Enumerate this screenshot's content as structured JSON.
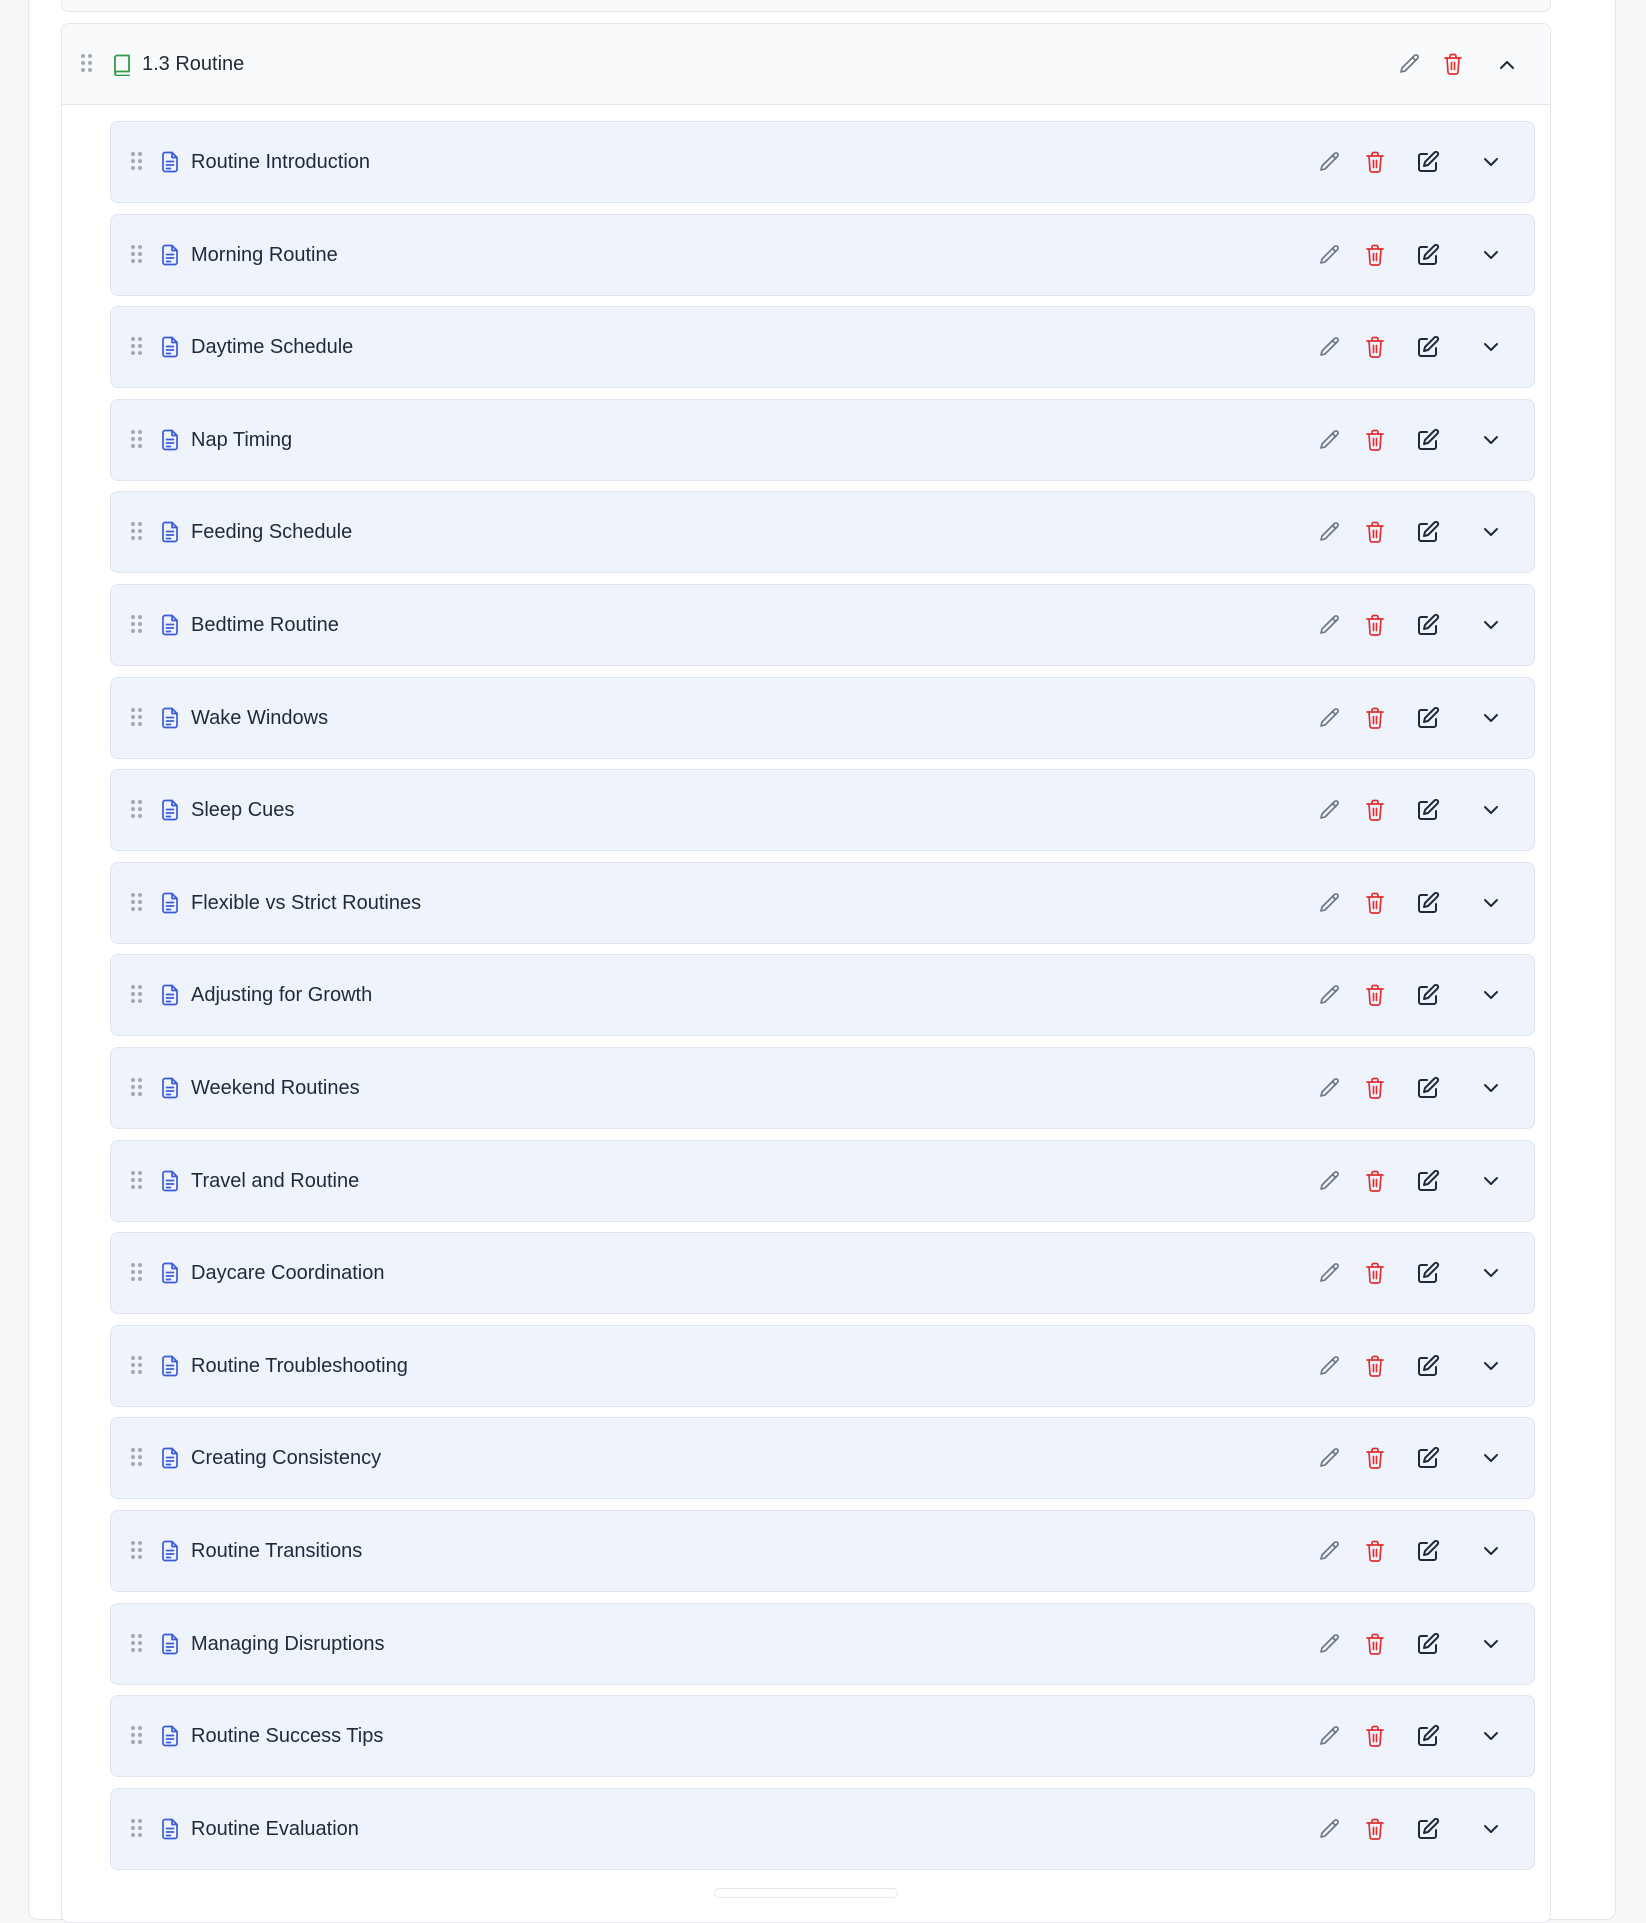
{
  "module": {
    "title": "1.3 Routine",
    "icon": "book-icon",
    "actions": [
      "edit-icon",
      "trash-icon",
      "chevron-up-icon"
    ]
  },
  "lessons": [
    {
      "title": "Routine Introduction"
    },
    {
      "title": "Morning Routine"
    },
    {
      "title": "Daytime Schedule"
    },
    {
      "title": "Nap Timing"
    },
    {
      "title": "Feeding Schedule"
    },
    {
      "title": "Bedtime Routine"
    },
    {
      "title": "Wake Windows"
    },
    {
      "title": "Sleep Cues"
    },
    {
      "title": "Flexible vs Strict Routines"
    },
    {
      "title": "Adjusting for Growth"
    },
    {
      "title": "Weekend Routines"
    },
    {
      "title": "Travel and Routine"
    },
    {
      "title": "Daycare Coordination"
    },
    {
      "title": "Routine Troubleshooting"
    },
    {
      "title": "Creating Consistency"
    },
    {
      "title": "Routine Transitions"
    },
    {
      "title": "Managing Disruptions"
    },
    {
      "title": "Routine Success Tips"
    },
    {
      "title": "Routine Evaluation"
    }
  ],
  "lesson_actions": [
    "pencil-icon",
    "trash-icon",
    "edit-content-icon",
    "chevron-down-icon"
  ],
  "colors": {
    "lesson_bg": "#eff4fc",
    "doc_icon": "#3b5bdb",
    "book_icon": "#2f9e44",
    "delete": "#e03131",
    "muted": "#6b7280"
  }
}
